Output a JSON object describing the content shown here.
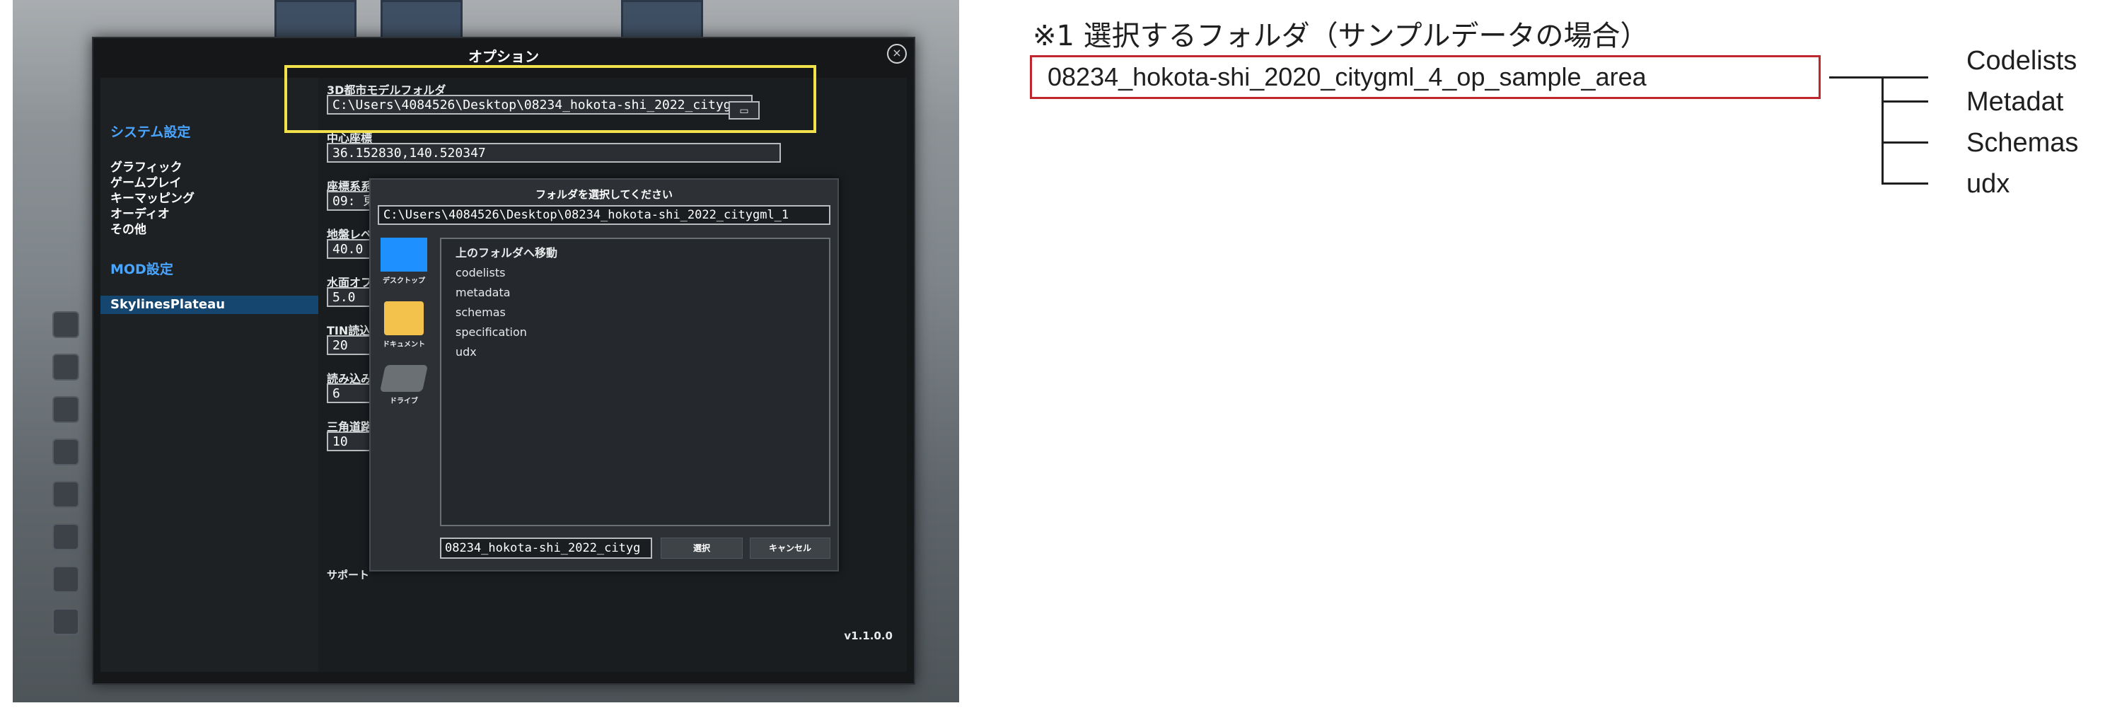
{
  "dialog": {
    "title": "オプション",
    "close_icon": "×",
    "sidebar": {
      "system_heading": "システム設定",
      "system_items": [
        "グラフィック",
        "ゲームプレイ",
        "キーマッピング",
        "オーディオ",
        "その他"
      ],
      "mod_heading": "MOD設定",
      "selected_item": "SkylinesPlateau"
    },
    "fields": [
      {
        "label": "3D都市モデルフォルダ",
        "value": "C:\\Users\\4084526\\Desktop\\08234_hokota-shi_2022_citygr"
      },
      {
        "label": "中心座標",
        "value": "36.152830,140.520347"
      },
      {
        "label": "座標系系",
        "value": "09: 東"
      },
      {
        "label": "地盤レベ",
        "value": "40.0"
      },
      {
        "label": "水面オフセ",
        "value": "5.0"
      },
      {
        "label": "TIN読込最",
        "value": "20"
      },
      {
        "label": "読み込み範",
        "value": "6"
      },
      {
        "label": "三角道路の",
        "value": "10"
      }
    ],
    "support_label": "サポート",
    "version": "v1.1.0.0"
  },
  "folder_dialog": {
    "title": "フォルダを選択してください",
    "path": "C:\\Users\\4084526\\Desktop\\08234_hokota-shi_2022_citygml_1",
    "places": [
      "デスクトップ",
      "ドキュメント",
      "ドライブ"
    ],
    "items": [
      "上のフォルダへ移動",
      "codelists",
      "metadata",
      "schemas",
      "specification",
      "udx"
    ],
    "filename": "08234_hokota-shi_2022_cityg",
    "select_button": "選択",
    "cancel_button": "キャンセル"
  },
  "annotation": {
    "title": "※1 選択するフォルダ（サンプルデータの場合）",
    "root_folder": "08234_hokota-shi_2020_citygml_4_op_sample_area",
    "subfolders": [
      "Codelists",
      "Metadat",
      "Schemas",
      "udx"
    ]
  },
  "colors": {
    "accent_blue": "#4aa5ff",
    "highlight_yellow": "#f2e14b",
    "annotation_red": "#c0272d"
  }
}
